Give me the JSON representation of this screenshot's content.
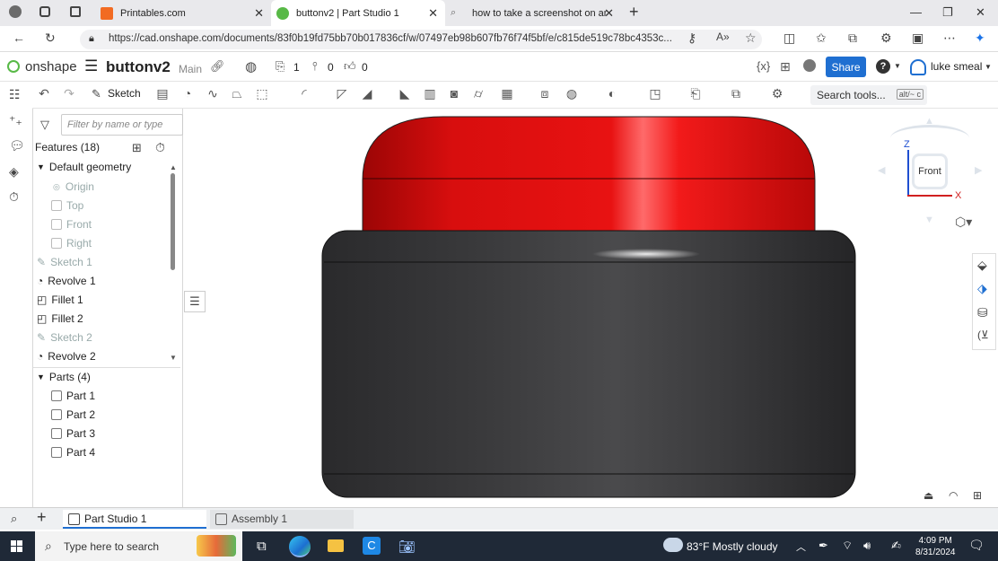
{
  "browser": {
    "tabs": [
      {
        "title": "Printables.com",
        "favicon_color": "#f26b22"
      },
      {
        "title": "buttonv2 | Part Studio 1",
        "favicon_color": "#58b947"
      },
      {
        "title": "how to take a screenshot on an a",
        "favicon_color": "#888888"
      }
    ],
    "url": "https://cad.onshape.com/documents/83f0b19fd75bb70b017836cf/w/07497eb98b607fb76f74f5bf/e/c815de519c78bc4353c..."
  },
  "header": {
    "logo": "onshape",
    "doc_title": "buttonv2",
    "branch": "Main",
    "versions_count": "1",
    "branches_count": "0",
    "likes_count": "0",
    "share_label": "Share",
    "user_name": "luke smeal",
    "brand_color": "#1f6fd1"
  },
  "toolbar": {
    "sketch_label": "Sketch",
    "search_label": "Search tools...",
    "search_shortcut": "alt/~",
    "search_key": "c"
  },
  "panel": {
    "filter_placeholder": "Filter by name or type",
    "features_label": "Features (18)",
    "default_geometry_label": "Default geometry",
    "geometry": [
      "Origin",
      "Top",
      "Front",
      "Right"
    ],
    "features": [
      "Sketch 1",
      "Revolve 1",
      "Fillet 1",
      "Fillet 2",
      "Sketch 2",
      "Revolve 2"
    ],
    "parts_label": "Parts (4)",
    "parts": [
      "Part 1",
      "Part 2",
      "Part 3",
      "Part 4"
    ]
  },
  "viewcube": {
    "face_label": "Front",
    "z_label": "Z",
    "x_label": "X"
  },
  "tabs_bottom": {
    "part_studio": "Part Studio 1",
    "assembly": "Assembly 1"
  },
  "taskbar": {
    "search_placeholder": "Type here to search",
    "weather": "83°F  Mostly cloudy",
    "time": "4:09 PM",
    "date": "8/31/2024"
  }
}
